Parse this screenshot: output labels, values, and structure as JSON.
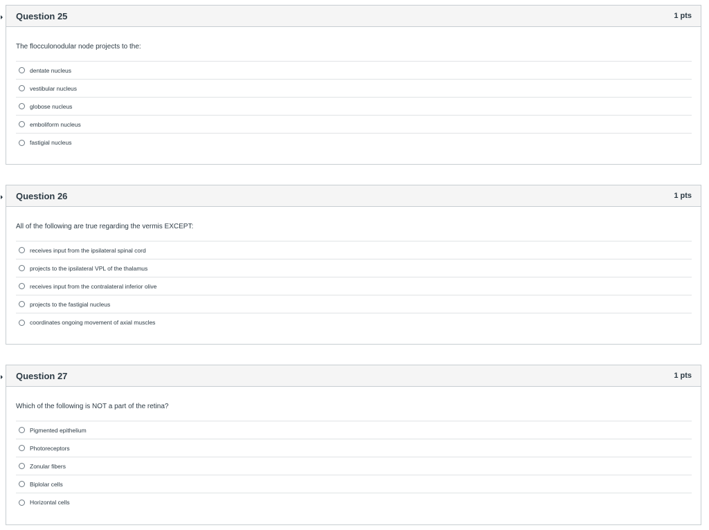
{
  "questions": [
    {
      "title": "Question 25",
      "points": "1 pts",
      "text": "The flocculonodular node projects to the:",
      "answers": [
        "dentate nucleus",
        "vestibular nucleus",
        "globose nucleus",
        "emboliform nucleus",
        "fastigial nucleus"
      ]
    },
    {
      "title": "Question 26",
      "points": "1 pts",
      "text": "All of the following are true regarding the vermis EXCEPT:",
      "answers": [
        "receives input from the ipsilateral spinal cord",
        "projects to the ipsilateral VPL of the thalamus",
        "receives input from the contralateral inferior olive",
        "projects to the fastigial nucleus",
        "coordinates ongoing movement of axial muscles"
      ]
    },
    {
      "title": "Question 27",
      "points": "1 pts",
      "text": "Which of the following is NOT a part of the retina?",
      "answers": [
        "Pigmented epithelium",
        "Photoreceptors",
        "Zonular fibers",
        "Biplolar cells",
        "Horizontal cells"
      ]
    }
  ]
}
